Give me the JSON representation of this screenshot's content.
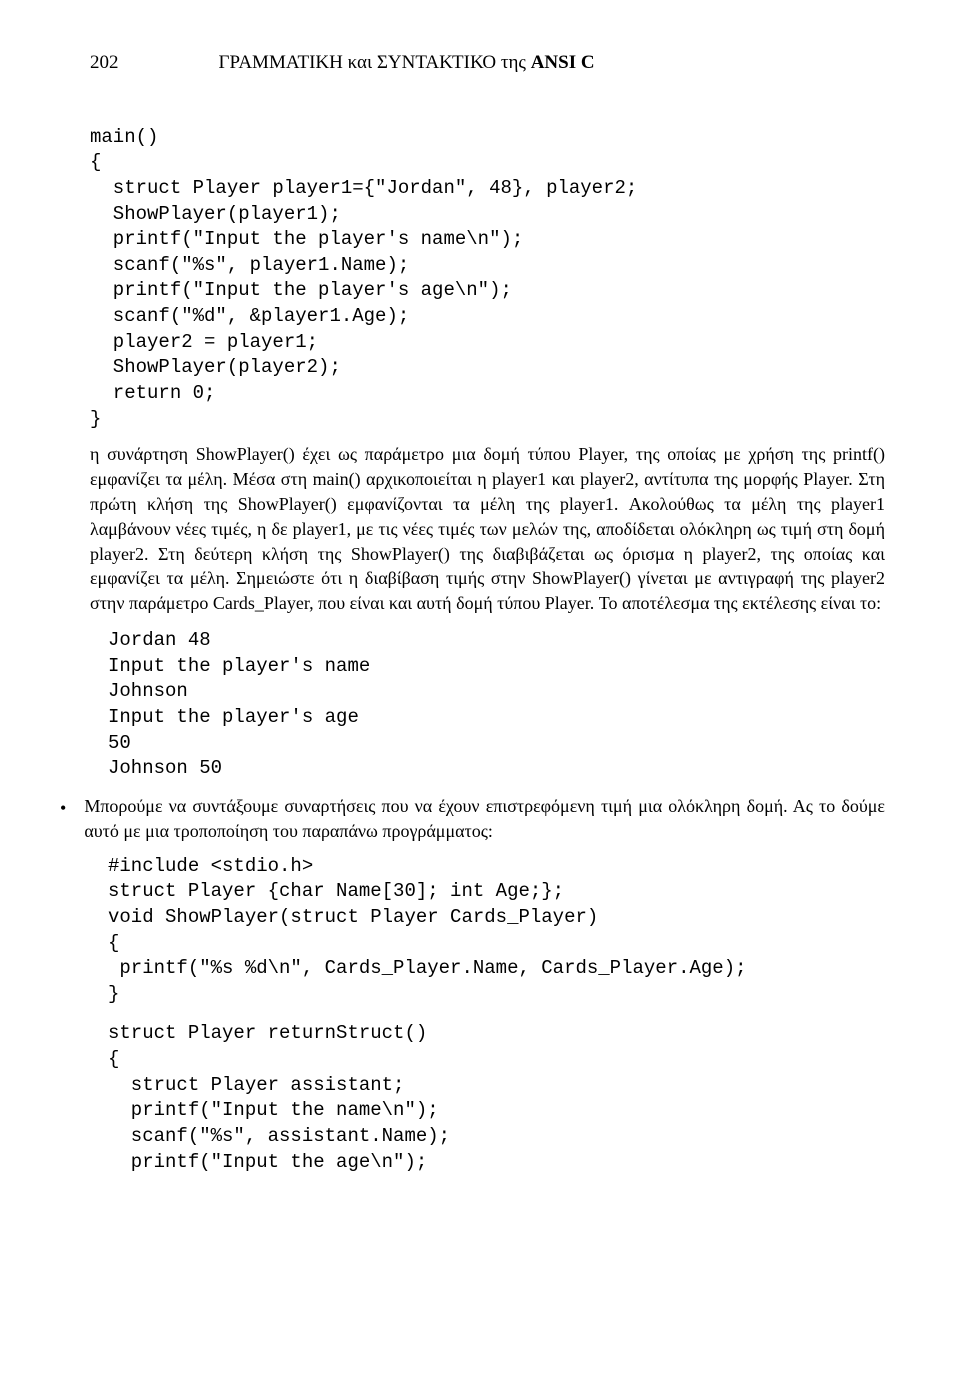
{
  "header": {
    "page_number": "202",
    "running_title_plain": "ΓΡΑΜΜΑΤΙΚΗ και ΣΥΝΤΑΚΤΙΚΟ της ",
    "running_title_bold": "ANSI C"
  },
  "code_block_1": "main()\n{\n  struct Player player1={\"Jordan\", 48}, player2;\n  ShowPlayer(player1);\n  printf(\"Input the player's name\\n\");\n  scanf(\"%s\", player1.Name);\n  printf(\"Input the player's age\\n\");\n  scanf(\"%d\", &player1.Age);\n  player2 = player1;\n  ShowPlayer(player2);\n  return 0;\n}",
  "paragraph_1": "η συνάρτηση ShowPlayer() έχει ως παράμετρο μια δομή τύπου Player, της οποίας με χρήση της printf() εμφανίζει τα μέλη. Μέσα στη main() αρχικοποιείται η player1 και player2, αντίτυπα της μορφής Player. Στη πρώτη κλήση της ShowPlayer() εμφανίζονται τα μέλη της player1. Ακολούθως τα μέλη της player1 λαμβάνουν νέες τιμές, η δε player1, με τις νέες τιμές των μελών της, αποδίδεται ολόκληρη ως τιμή στη δομή player2. Στη δεύτερη κλήση της ShowPlayer() της διαβιβάζεται ως όρισμα η player2, της οποίας και εμφανίζει τα μέλη. Σημειώστε ότι η διαβίβαση τιμής στην ShowPlayer() γίνεται με αντιγραφή της player2 στην παράμετρο Cards_Player, που είναι και αυτή δομή τύπου Player. Το αποτέλεσμα της εκτέλεσης είναι το:",
  "output_1": "Jordan 48\nInput the player's name\nJohnson\nInput the player's age\n50\nJohnson 50",
  "bullet_1": "Μπορούμε να συντάξουμε συναρτήσεις που να έχουν επιστρεφόμενη τιμή μια ολόκληρη δομή. Ας το δούμε αυτό με μια τροποποίηση του παραπάνω προγράμματος:",
  "code_block_2": "#include <stdio.h>\nstruct Player {char Name[30]; int Age;};\nvoid ShowPlayer(struct Player Cards_Player)\n{\n printf(\"%s %d\\n\", Cards_Player.Name, Cards_Player.Age);\n}",
  "code_block_3": "struct Player returnStruct()\n{\n  struct Player assistant;\n  printf(\"Input the name\\n\");\n  scanf(\"%s\", assistant.Name);\n  printf(\"Input the age\\n\");"
}
